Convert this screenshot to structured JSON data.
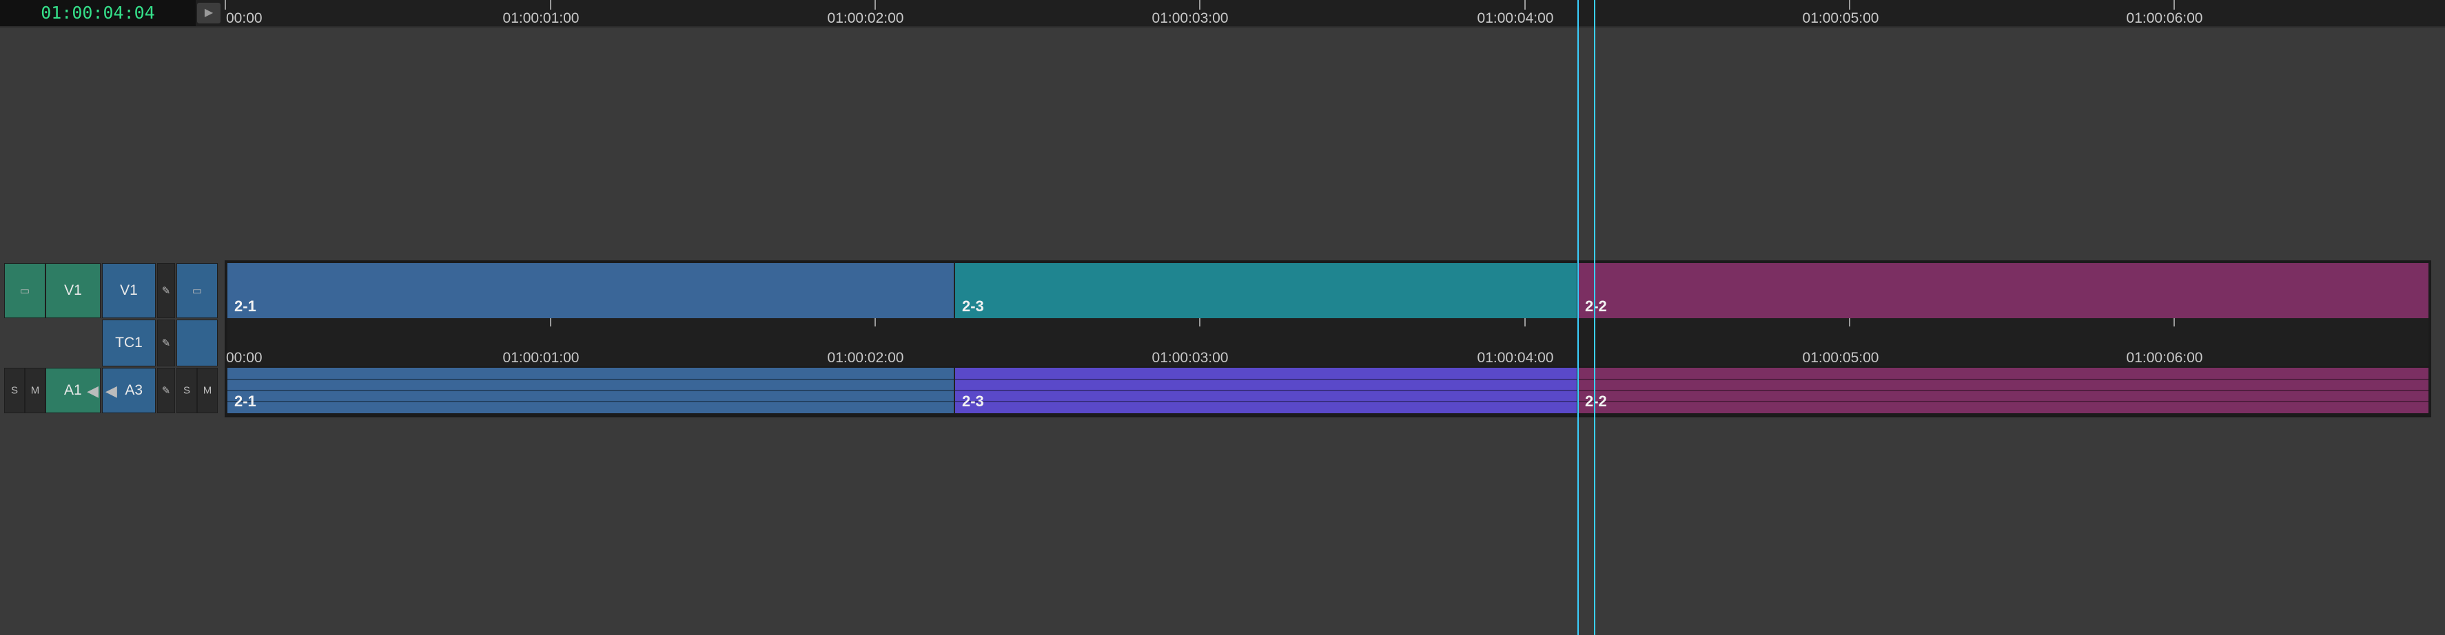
{
  "timecode": "01:00:04:04",
  "ruler": {
    "labels": [
      "00:00",
      "01:00:01:00",
      "01:00:02:00",
      "01:00:03:00",
      "01:00:04:00",
      "01:00:05:00",
      "01:00:06:00"
    ]
  },
  "tracks": {
    "video": {
      "patch_label": "V1",
      "track_label": "V1"
    },
    "timecode": {
      "track_label": "TC1"
    },
    "audio": {
      "patch_label": "A1",
      "track_label": "A3",
      "solo": "S",
      "mute": "M",
      "solo2": "S",
      "mute2": "M"
    }
  },
  "clips": {
    "video": [
      {
        "name": "2-1",
        "color": "#3a6698"
      },
      {
        "name": "2-3",
        "color": "#1f8590"
      },
      {
        "name": "2-2",
        "color": "#7b2f62"
      }
    ],
    "audio": [
      {
        "name": "2-1",
        "color": "#3a6698"
      },
      {
        "name": "2-3",
        "color": "#5a49c9"
      },
      {
        "name": "2-2",
        "color": "#7b2f62"
      }
    ]
  },
  "icons": [
    "play-icon",
    "monitor-icon",
    "pencil-icon",
    "speaker-icon"
  ]
}
